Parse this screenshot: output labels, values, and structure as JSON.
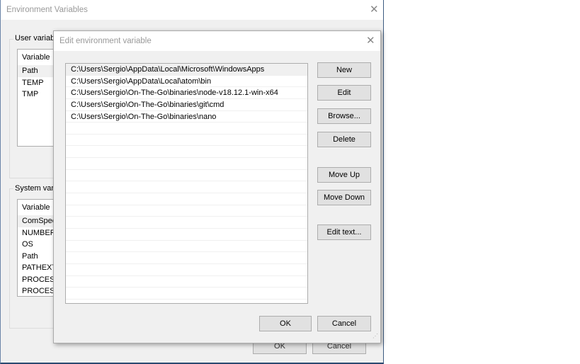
{
  "outer": {
    "title": "Environment Variables",
    "user_group": "User variable",
    "user_header": "Variable",
    "user_vars": [
      "Path",
      "TEMP",
      "TMP"
    ],
    "system_group": "System varia",
    "system_header": "Variable",
    "system_vars": [
      "ComSpec",
      "NUMBER_",
      "OS",
      "Path",
      "PATHEXT",
      "PROCESS",
      "PROCESS"
    ],
    "ok": "OK",
    "cancel": "Cancel"
  },
  "dialog": {
    "title": "Edit environment variable",
    "entries": [
      "C:\\Users\\Sergio\\AppData\\Local\\Microsoft\\WindowsApps",
      "C:\\Users\\Sergio\\AppData\\Local\\atom\\bin",
      "C:\\Users\\Sergio\\On-The-Go\\binaries\\node-v18.12.1-win-x64",
      "C:\\Users\\Sergio\\On-The-Go\\binaries\\git\\cmd",
      "C:\\Users\\Sergio\\On-The-Go\\binaries\\nano"
    ],
    "buttons": {
      "new": "New",
      "edit": "Edit",
      "browse": "Browse...",
      "delete": "Delete",
      "move_up": "Move Up",
      "move_down": "Move Down",
      "edit_text": "Edit text..."
    },
    "ok": "OK",
    "cancel": "Cancel"
  }
}
